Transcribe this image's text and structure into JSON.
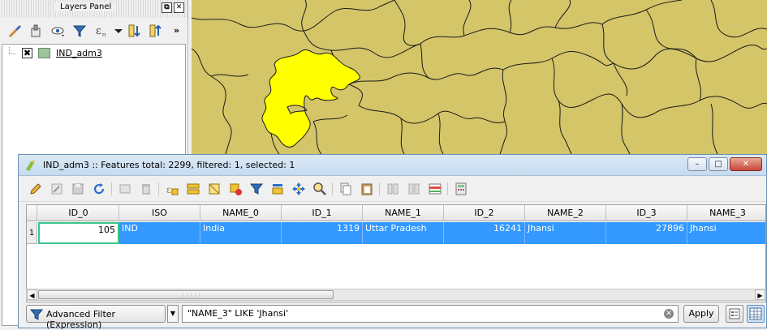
{
  "layers_panel": {
    "title": "Layers Panel",
    "float_button": "⧉",
    "close_button": "✕",
    "overflow": "»",
    "layers": [
      {
        "name": "IND_adm3",
        "visible": true,
        "check_mark": "✖",
        "swatch_color": "#9dc49a"
      }
    ]
  },
  "map": {
    "background_color": "#d3c568",
    "selected_fill": "#ffff00",
    "boundary_color": "#1a1a1a"
  },
  "attribute_table": {
    "title": "IND_adm3 :: Features total: 2299, filtered: 1, selected: 1",
    "window_controls": {
      "minimize": "–",
      "maximize": "□",
      "close": "✕"
    },
    "columns": [
      "ID_0",
      "ISO",
      "NAME_0",
      "ID_1",
      "NAME_1",
      "ID_2",
      "NAME_2",
      "ID_3",
      "NAME_3"
    ],
    "rows": [
      {
        "row_number": "1",
        "cells": [
          "105",
          "IND",
          "India",
          "1319",
          "Uttar Pradesh",
          "16241",
          "Jhansi",
          "27896",
          "Jhansi"
        ]
      }
    ],
    "scroll_left": "◀",
    "scroll_right": "▶",
    "scroll_grip": "⋮⋮⋮⋮⋮",
    "filter": {
      "mode_label": "Advanced Filter (Expression)",
      "dropdown_arrow": "▼",
      "expression": "\"NAME_3\" LIKE 'Jhansi'",
      "clear_symbol": "✕",
      "apply_label": "Apply"
    }
  }
}
